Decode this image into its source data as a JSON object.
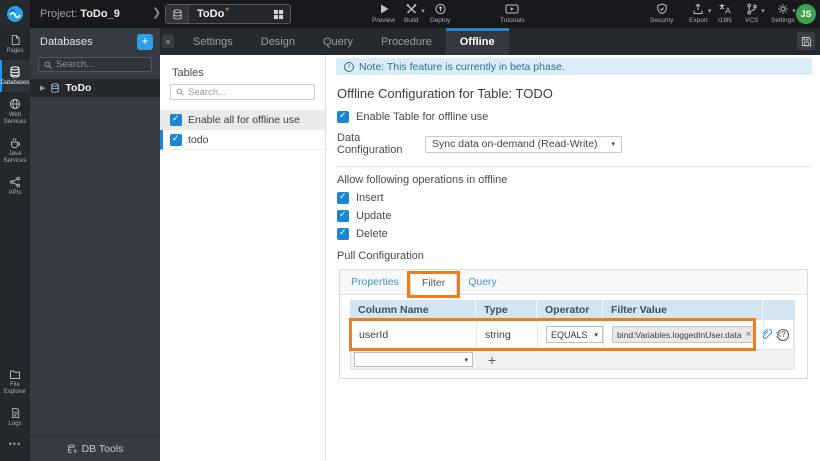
{
  "topbar": {
    "project_label": "Project:",
    "project_name": "ToDo_9",
    "selector": {
      "name": "ToDo",
      "modified_marker": "*"
    },
    "left_actions": [
      {
        "label": "Preview",
        "icon": "play-icon"
      },
      {
        "label": "Build",
        "icon": "build-icon",
        "caret": true
      },
      {
        "label": "Deploy",
        "icon": "deploy-icon"
      },
      {
        "label": "Tutorials",
        "icon": "tutorials-icon"
      }
    ],
    "right_actions": [
      {
        "label": "Security",
        "icon": "shield-icon"
      },
      {
        "label": "Export",
        "icon": "export-icon",
        "caret": true
      },
      {
        "label": "I18N",
        "icon": "i18n-icon"
      },
      {
        "label": "VCS",
        "icon": "vcs-icon",
        "caret": true
      },
      {
        "label": "Settings",
        "icon": "gear-icon",
        "caret": true
      }
    ],
    "avatar_initials": "JS"
  },
  "left_rail": {
    "items": [
      {
        "label": "Pages",
        "icon": "pages-icon",
        "active": false
      },
      {
        "label": "Databases",
        "icon": "database-icon",
        "active": true
      },
      {
        "label": "Web\nServices",
        "icon": "globe-icon",
        "active": false
      },
      {
        "label": "Java\nServices",
        "icon": "java-icon",
        "active": false
      },
      {
        "label": "APIs",
        "icon": "api-icon",
        "active": false
      }
    ],
    "bottom_items": [
      {
        "label": "File\nExplorer",
        "icon": "folder-icon"
      },
      {
        "label": "Logs",
        "icon": "logs-icon"
      }
    ],
    "more_label": "•••"
  },
  "db_panel": {
    "title": "Databases",
    "add_label": "+",
    "search_placeholder": "Search...",
    "tree_item": {
      "label": "ToDo",
      "expand_glyph": "▶"
    },
    "footer_label": "DB Tools"
  },
  "editor_tabs": {
    "collapse_glyph": "«",
    "items": [
      {
        "label": "Settings",
        "active": false
      },
      {
        "label": "Design",
        "active": false
      },
      {
        "label": "Query",
        "active": false
      },
      {
        "label": "Procedure",
        "active": false
      },
      {
        "label": "Offline",
        "active": true
      }
    ]
  },
  "tables_panel": {
    "title": "Tables",
    "search_placeholder": "Search...",
    "enable_all": {
      "label": "Enable all for offline use",
      "checked": true
    },
    "tables": [
      {
        "label": "todo",
        "checked": true,
        "selected": true
      }
    ]
  },
  "offline_config": {
    "note": "Note: This feature is currently in beta phase.",
    "heading": "Offline Configuration for Table: TODO",
    "enable_label": "Enable Table for offline use",
    "enable_checked": true,
    "data_config_label": "Data Configuration",
    "data_config_value": "Sync data on-demand (Read-Write)",
    "operations_label": "Allow following operations in offline",
    "operations": [
      {
        "label": "Insert",
        "checked": true
      },
      {
        "label": "Update",
        "checked": true
      },
      {
        "label": "Delete",
        "checked": true
      }
    ],
    "pull_label": "Pull Configuration",
    "pull_tabs": [
      {
        "label": "Properties",
        "active": false
      },
      {
        "label": "Filter",
        "active": true
      },
      {
        "label": "Query",
        "active": false
      }
    ],
    "filter_table": {
      "headers": [
        "Column Name",
        "Type",
        "Operator",
        "Filter Value"
      ],
      "rows": [
        {
          "column_name": "userId",
          "type": "string",
          "operator": "EQUALS",
          "filter_value": "bind:Variables.loggedInUser.data"
        }
      ],
      "add_row_label": "+"
    }
  },
  "glyphs": {
    "caret_down": "▾",
    "select_arrow": "▾",
    "close": "×",
    "question": "?",
    "info": "i"
  },
  "colors": {
    "accent_blue": "#2086d2",
    "link_blue": "#4193d8",
    "annotation_orange": "#ee7d1d",
    "note_bg": "#d9edf7",
    "table_header_bg": "#d5e4f1",
    "checkbox_blue": "#1b87d4",
    "avatar_green": "#3da24d",
    "topbar_bg": "#17191c"
  }
}
